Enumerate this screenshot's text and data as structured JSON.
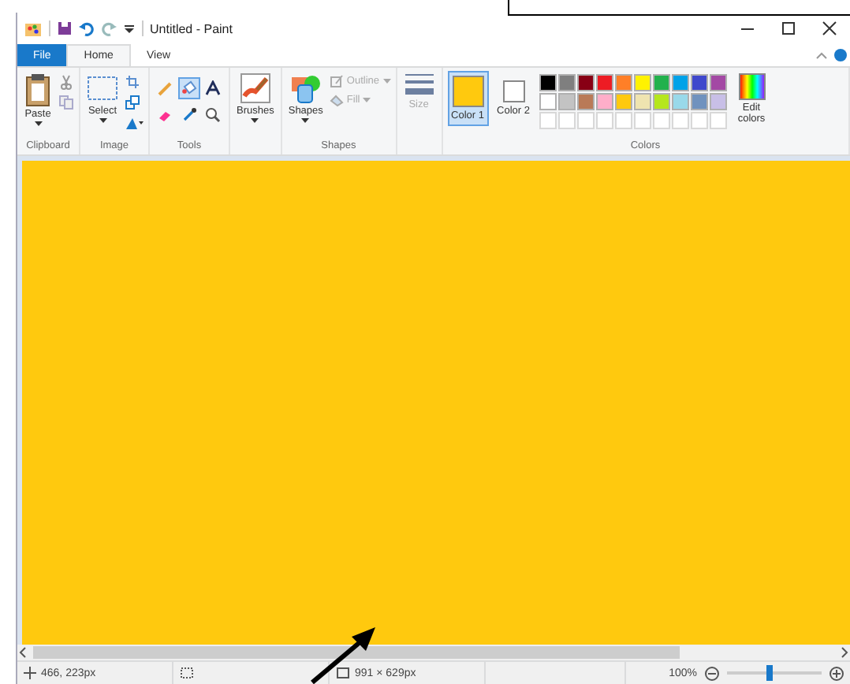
{
  "window": {
    "title": "Untitled - Paint"
  },
  "tabs": [
    {
      "label": "File",
      "kind": "file",
      "selected": false
    },
    {
      "label": "Home",
      "kind": "tab",
      "selected": true
    },
    {
      "label": "View",
      "kind": "tab",
      "selected": false
    }
  ],
  "clipboard": {
    "label": "Clipboard",
    "paste": "Paste"
  },
  "image": {
    "label": "Image",
    "select": "Select"
  },
  "tools": {
    "label": "Tools",
    "items": [
      {
        "selected": false
      },
      {
        "selected": true
      },
      {
        "selected": false
      },
      {
        "selected": false
      },
      {
        "selected": false
      },
      {
        "selected": false
      }
    ]
  },
  "brushes": {
    "label": "Brushes"
  },
  "shapes": {
    "label": "Shapes",
    "button": "Shapes",
    "outline": {
      "label": "Outline",
      "disabled": true
    },
    "fill": {
      "label": "Fill",
      "disabled": true
    }
  },
  "size": {
    "label": "Size",
    "disabled": true
  },
  "colors": {
    "label": "Colors",
    "slots": [
      {
        "label": "Color 1",
        "color": "#ffc90e",
        "selected": true
      },
      {
        "label": "Color 2",
        "color": "#ffffff",
        "selected": false
      }
    ],
    "palette": [
      {
        "color": "#000000"
      },
      {
        "color": "#7f7f7f"
      },
      {
        "color": "#880015"
      },
      {
        "color": "#ed1c24"
      },
      {
        "color": "#ff7f27"
      },
      {
        "color": "#fff200"
      },
      {
        "color": "#22b14c"
      },
      {
        "color": "#00a2e8"
      },
      {
        "color": "#3f48cc"
      },
      {
        "color": "#a349a4"
      },
      {
        "color": "#ffffff"
      },
      {
        "color": "#c3c3c3"
      },
      {
        "color": "#b97a57"
      },
      {
        "color": "#ffaec9"
      },
      {
        "color": "#ffc90e"
      },
      {
        "color": "#efe4b0"
      },
      {
        "color": "#b5e61d"
      },
      {
        "color": "#99d9ea"
      },
      {
        "color": "#7092be"
      },
      {
        "color": "#c8bfe7"
      },
      {
        "kind": "empty"
      },
      {
        "kind": "empty"
      },
      {
        "kind": "empty"
      },
      {
        "kind": "empty"
      },
      {
        "kind": "empty"
      },
      {
        "kind": "empty"
      },
      {
        "kind": "empty"
      },
      {
        "kind": "empty"
      },
      {
        "kind": "empty"
      },
      {
        "kind": "empty"
      }
    ],
    "edit": "Edit colors"
  },
  "status": {
    "cursor": "466, 223px",
    "dimensions": "991 × 629px",
    "zoom": "100%",
    "zoom_slider": {
      "level": 0.45
    }
  }
}
